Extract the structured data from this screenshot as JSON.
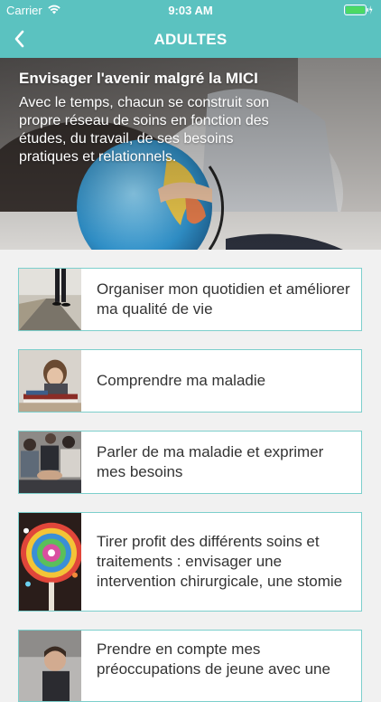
{
  "status": {
    "carrier": "Carrier",
    "time": "9:03 AM"
  },
  "nav": {
    "title": "ADULTES",
    "back_icon": "chevron-left-icon"
  },
  "hero": {
    "title": "Envisager l'avenir malgré la MICI",
    "body": "Avec le temps, chacun se construit son propre réseau de soins en fonction des études, du travail, de ses besoins pratiques et relationnels."
  },
  "items": [
    {
      "label": "Organiser mon quotidien et améliorer ma qualité de vie"
    },
    {
      "label": "Comprendre ma maladie"
    },
    {
      "label": "Parler de ma maladie et exprimer mes besoins"
    },
    {
      "label": "Tirer profit des différents soins et traitements : envisager une intervention chirurgicale, une stomie"
    },
    {
      "label": "Prendre en compte mes préoccupations de jeune avec une"
    }
  ],
  "colors": {
    "accent": "#5bc2c0",
    "card_border": "#7ccfcc",
    "background": "#f1f1f1"
  }
}
